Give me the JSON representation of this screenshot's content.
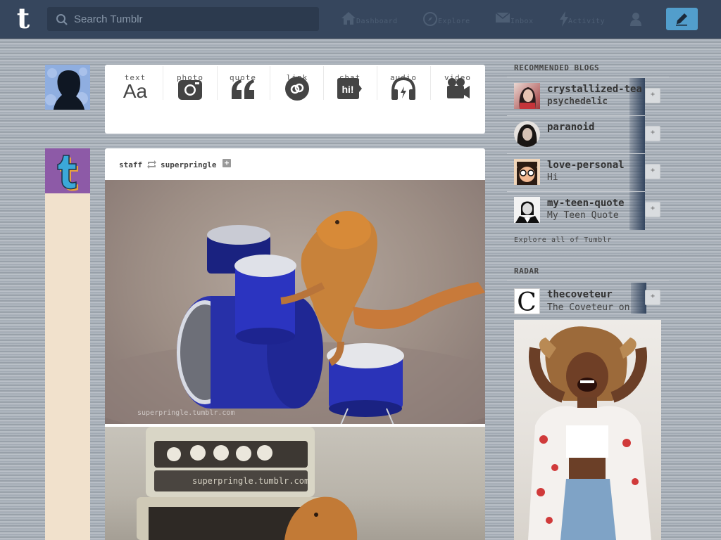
{
  "header": {
    "logo_letter": "t",
    "search_placeholder": "Search Tumblr",
    "nav": [
      {
        "label": "Dashboard",
        "icon": "home-icon"
      },
      {
        "label": "Explore",
        "icon": "compass-icon"
      },
      {
        "label": "Inbox",
        "icon": "envelope-icon"
      },
      {
        "label": "Activity",
        "icon": "lightning-icon"
      },
      {
        "label": "",
        "icon": "user-icon"
      }
    ],
    "compose_icon": "pencil-icon",
    "colors": {
      "bar": "#36465d",
      "compose": "#529ecc"
    }
  },
  "post_types": [
    {
      "label": "text",
      "glyph": "Aa",
      "icon": "text-icon"
    },
    {
      "label": "photo",
      "icon": "camera-icon"
    },
    {
      "label": "quote",
      "icon": "quote-icon"
    },
    {
      "label": "link",
      "icon": "link-icon"
    },
    {
      "label": "chat",
      "glyph": "hi!",
      "icon": "chat-icon"
    },
    {
      "label": "audio",
      "icon": "headphones-icon"
    },
    {
      "label": "video",
      "icon": "video-camera-icon"
    }
  ],
  "post": {
    "blog": "staff",
    "reblogged_from": "superpringle",
    "follow_glyph": "+",
    "photos": [
      {
        "watermark": "superpringle.tumblr.com"
      },
      {
        "watermark": "superpringle.tumblr.com"
      }
    ]
  },
  "sidebar": {
    "recommended_title": "RECOMMENDED BLOGS",
    "recommended": [
      {
        "name": "crystallized-tea",
        "subtitle": "psychedelic"
      },
      {
        "name": "paranoid",
        "subtitle": ""
      },
      {
        "name": "love-personal",
        "subtitle": "Hi"
      },
      {
        "name": "my-teen-quote",
        "subtitle": "My Teen Quote"
      }
    ],
    "follow_glyph": "+",
    "explore_link": "Explore all of Tumblr",
    "radar_title": "RADAR",
    "radar": {
      "name": "thecoveteur",
      "subtitle": "The Coveteur on",
      "avatar_letter": "C"
    }
  }
}
